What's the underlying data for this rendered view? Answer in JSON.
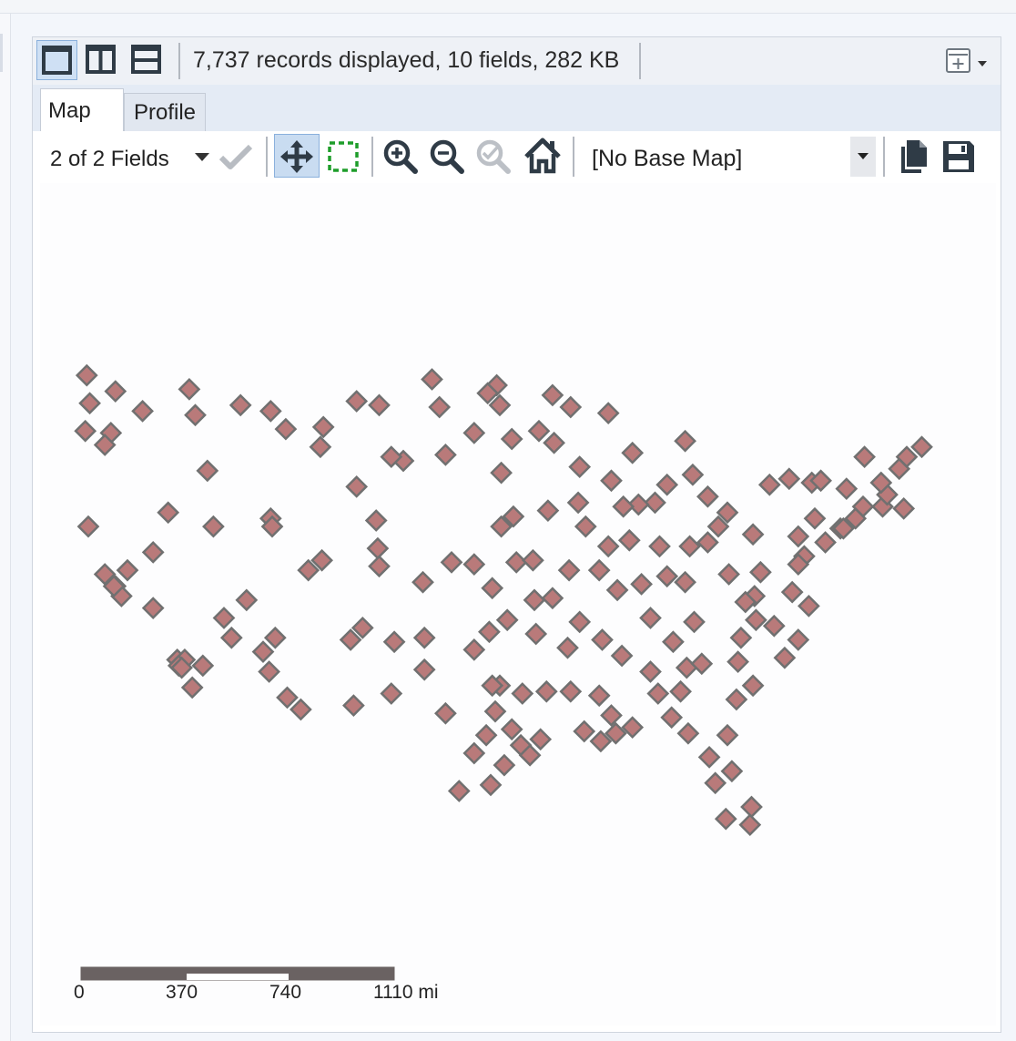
{
  "toolbar": {
    "layout_buttons": [
      {
        "name": "single-view-icon",
        "active": true
      },
      {
        "name": "vertical-split-icon",
        "active": false
      },
      {
        "name": "horizontal-split-icon",
        "active": false
      }
    ],
    "status_text": "7,737 records displayed, 10 fields, 282 KB",
    "menu_icon": "add-panel-dropdown-icon"
  },
  "tabs": [
    {
      "label": "Map",
      "selected": true
    },
    {
      "label": "Profile",
      "selected": false
    }
  ],
  "map_toolbar": {
    "fields_selector": "2 of 2 Fields",
    "basemap_selected": "[No Base Map]",
    "tools": [
      "checkmark-icon",
      "pan-icon",
      "select-rectangle-icon",
      "zoom-in-icon",
      "zoom-out-icon",
      "zoom-to-selection-icon",
      "home-icon",
      "copy-icon",
      "save-icon"
    ]
  },
  "map": {
    "marker_fill": "#b97a7a",
    "marker_stroke": "#707070",
    "scale_bar": {
      "labels": [
        "0",
        "370",
        "740",
        "1110 mi"
      ]
    },
    "points": [
      [
        -124.2,
        48.4
      ],
      [
        -124.0,
        47.0
      ],
      [
        -124.3,
        45.6
      ],
      [
        -122.3,
        47.6
      ],
      [
        -122.6,
        45.5
      ],
      [
        -117.4,
        47.7
      ],
      [
        -117.0,
        46.4
      ],
      [
        -116.2,
        43.6
      ],
      [
        -112.0,
        46.6
      ],
      [
        -111.0,
        45.7
      ],
      [
        -108.5,
        45.8
      ],
      [
        -106.3,
        47.1
      ],
      [
        -104.8,
        46.9
      ],
      [
        -100.8,
        46.8
      ],
      [
        -97.0,
        47.9
      ],
      [
        -96.8,
        46.9
      ],
      [
        -98.5,
        45.5
      ],
      [
        -96.7,
        43.5
      ],
      [
        -100.4,
        44.4
      ],
      [
        -103.2,
        44.1
      ],
      [
        -104.0,
        44.3
      ],
      [
        -101.3,
        48.2
      ],
      [
        -97.6,
        47.5
      ],
      [
        -93.3,
        47.4
      ],
      [
        -92.1,
        46.8
      ],
      [
        -89.6,
        46.5
      ],
      [
        -88.0,
        44.5
      ],
      [
        -89.4,
        43.1
      ],
      [
        -93.2,
        45.0
      ],
      [
        -94.2,
        45.6
      ],
      [
        -84.5,
        45.1
      ],
      [
        -83.0,
        42.3
      ],
      [
        -85.7,
        42.9
      ],
      [
        -86.5,
        42.0
      ],
      [
        -87.6,
        41.9
      ],
      [
        -88.2,
        40.1
      ],
      [
        -89.6,
        39.8
      ],
      [
        -90.2,
        38.6
      ],
      [
        -91.1,
        40.8
      ],
      [
        -93.6,
        41.6
      ],
      [
        -95.9,
        41.3
      ],
      [
        -96.7,
        40.8
      ],
      [
        -95.7,
        39.0
      ],
      [
        -94.6,
        39.1
      ],
      [
        -97.3,
        37.7
      ],
      [
        -98.5,
        38.9
      ],
      [
        -101.9,
        38.0
      ],
      [
        -100.0,
        39.0
      ],
      [
        -104.9,
        39.7
      ],
      [
        -104.8,
        38.8
      ],
      [
        -106.7,
        35.1
      ],
      [
        -108.6,
        39.1
      ],
      [
        -105.9,
        35.7
      ],
      [
        -103.8,
        35.0
      ],
      [
        -110.9,
        32.2
      ],
      [
        -112.1,
        33.5
      ],
      [
        -111.7,
        35.2
      ],
      [
        -114.6,
        35.2
      ],
      [
        -115.1,
        36.2
      ],
      [
        -117.2,
        32.7
      ],
      [
        -118.2,
        34.1
      ],
      [
        -119.8,
        36.7
      ],
      [
        -121.5,
        38.6
      ],
      [
        -122.3,
        37.8
      ],
      [
        -121.9,
        37.3
      ],
      [
        -122.4,
        37.8
      ],
      [
        -123.0,
        38.4
      ],
      [
        -124.1,
        40.8
      ],
      [
        -119.8,
        39.5
      ],
      [
        -116.5,
        33.8
      ],
      [
        -117.7,
        34.1
      ],
      [
        -118.1,
        33.8
      ],
      [
        -117.9,
        33.7
      ],
      [
        -112.0,
        41.2
      ],
      [
        -111.9,
        40.8
      ],
      [
        -113.6,
        37.1
      ],
      [
        -106.5,
        31.8
      ],
      [
        -104.0,
        32.4
      ],
      [
        -101.8,
        33.6
      ],
      [
        -101.8,
        35.2
      ],
      [
        -99.5,
        27.5
      ],
      [
        -97.4,
        27.8
      ],
      [
        -98.5,
        29.4
      ],
      [
        -97.7,
        30.3
      ],
      [
        -96.8,
        32.8
      ],
      [
        -97.3,
        32.8
      ],
      [
        -95.4,
        29.8
      ],
      [
        -94.1,
        30.1
      ],
      [
        -96.0,
        30.6
      ],
      [
        -97.1,
        31.5
      ],
      [
        -95.3,
        32.4
      ],
      [
        -96.3,
        36.1
      ],
      [
        -97.5,
        35.5
      ],
      [
        -98.5,
        34.6
      ],
      [
        -94.4,
        35.4
      ],
      [
        -92.3,
        34.7
      ],
      [
        -93.7,
        32.5
      ],
      [
        -92.1,
        32.5
      ],
      [
        -91.2,
        30.5
      ],
      [
        -90.1,
        30.0
      ],
      [
        -89.1,
        30.4
      ],
      [
        -88.0,
        30.7
      ],
      [
        -86.8,
        33.5
      ],
      [
        -86.3,
        32.4
      ],
      [
        -85.4,
        31.2
      ],
      [
        -84.3,
        30.4
      ],
      [
        -81.7,
        30.3
      ],
      [
        -82.5,
        27.9
      ],
      [
        -81.4,
        28.5
      ],
      [
        -80.1,
        26.7
      ],
      [
        -80.2,
        25.8
      ],
      [
        -81.8,
        26.1
      ],
      [
        -84.4,
        33.7
      ],
      [
        -83.4,
        33.9
      ],
      [
        -81.1,
        32.1
      ],
      [
        -80.0,
        32.8
      ],
      [
        -81.0,
        34.0
      ],
      [
        -80.8,
        35.2
      ],
      [
        -78.6,
        35.8
      ],
      [
        -77.9,
        34.2
      ],
      [
        -77.0,
        35.1
      ],
      [
        -79.8,
        36.1
      ],
      [
        -77.4,
        37.5
      ],
      [
        -76.3,
        36.8
      ],
      [
        -79.9,
        37.3
      ],
      [
        -80.5,
        37.0
      ],
      [
        -81.6,
        38.4
      ],
      [
        -83.0,
        40.0
      ],
      [
        -84.2,
        39.8
      ],
      [
        -81.7,
        41.5
      ],
      [
        -80.0,
        40.4
      ],
      [
        -77.0,
        40.3
      ],
      [
        -75.2,
        40.0
      ],
      [
        -76.6,
        39.3
      ],
      [
        -77.0,
        38.9
      ],
      [
        -74.2,
        40.7
      ],
      [
        -74.0,
        40.7
      ],
      [
        -73.8,
        42.7
      ],
      [
        -76.1,
        43.0
      ],
      [
        -77.6,
        43.2
      ],
      [
        -78.9,
        42.9
      ],
      [
        -72.7,
        41.8
      ],
      [
        -71.4,
        41.8
      ],
      [
        -71.1,
        42.4
      ],
      [
        -70.3,
        43.7
      ],
      [
        -69.8,
        44.3
      ],
      [
        -68.8,
        44.8
      ],
      [
        -72.6,
        44.3
      ],
      [
        -71.5,
        43.0
      ],
      [
        -86.2,
        39.8
      ],
      [
        -85.7,
        38.3
      ],
      [
        -84.5,
        38.0
      ],
      [
        -86.8,
        36.2
      ],
      [
        -85.3,
        35.0
      ],
      [
        -83.9,
        36.0
      ],
      [
        -90.0,
        35.1
      ],
      [
        -88.7,
        34.3
      ],
      [
        -90.2,
        32.3
      ],
      [
        -89.4,
        31.3
      ],
      [
        -87.4,
        37.9
      ],
      [
        -94.5,
        37.1
      ],
      [
        -93.3,
        37.2
      ],
      [
        -92.2,
        38.6
      ],
      [
        -82.3,
        40.8
      ],
      [
        -75.5,
        43.1
      ],
      [
        -73.2,
        41.2
      ],
      [
        -105.0,
        41.1
      ],
      [
        -106.3,
        42.8
      ],
      [
        -108.7,
        44.8
      ],
      [
        -114.0,
        46.9
      ],
      [
        -120.5,
        46.6
      ],
      [
        -123.0,
        44.9
      ],
      [
        -118.8,
        41.5
      ],
      [
        -115.8,
        40.8
      ],
      [
        -109.5,
        38.6
      ],
      [
        -112.5,
        34.5
      ],
      [
        -110.0,
        31.6
      ],
      [
        -100.4,
        31.4
      ],
      [
        -96.5,
        28.8
      ],
      [
        -94.8,
        29.3
      ],
      [
        -82.9,
        29.2
      ],
      [
        -84.8,
        32.5
      ],
      [
        -91.5,
        36.0
      ],
      [
        -89.0,
        37.6
      ],
      [
        -88.6,
        41.8
      ],
      [
        -91.6,
        42.0
      ],
      [
        -96.0,
        45.2
      ],
      [
        -91.5,
        43.8
      ],
      [
        -84.0,
        43.4
      ],
      [
        -70.0,
        41.7
      ],
      [
        -75.9,
        41.2
      ],
      [
        -79.5,
        38.5
      ]
    ]
  }
}
